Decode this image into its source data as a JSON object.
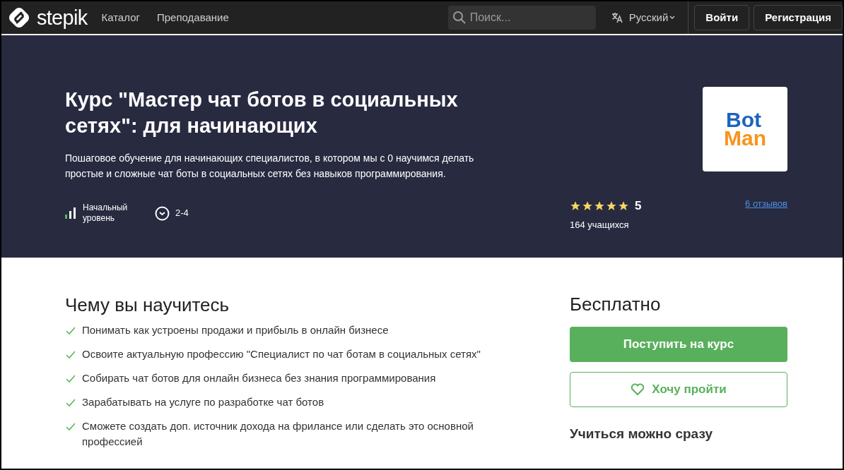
{
  "header": {
    "logo_text": "stepik",
    "nav": [
      "Каталог",
      "Преподавание"
    ],
    "search": {
      "placeholder": "Поиск..."
    },
    "language": "Русский",
    "buttons": [
      "Войти",
      "Регистрация"
    ]
  },
  "hero": {
    "title": "Курс \"Мастер чат ботов в социальных сетях\": для начинающих",
    "description": "Пошаговое обучение для начинающих специалистов, в котором мы с 0 научимся делать простые и сложные чат боты в социальных сетях без навыков программирования.",
    "level_label": "Начальный уровень",
    "duration": "2-4",
    "cover": {
      "line_1": "Bot",
      "line_2": "Man"
    },
    "stars": 5,
    "rating": "5",
    "students": "164 учащихся",
    "reviews": "6 отзывов"
  },
  "learn": {
    "title": "Чему вы научитесь",
    "items": [
      "Понимать как устроены продажи и прибыль в онлайн бизнесе",
      "Освоите актуальную профессию \"Специалист по чат ботам в социальных сетях\"",
      "Собирать чат ботов для онлайн бизнеса без знания программирования",
      "Зарабатывать на услуге по разработке чат ботов",
      "Сможете создать доп. источник дохода на фрилансе или сделать это основной профессией"
    ]
  },
  "offer": {
    "price": "Бесплатно",
    "enroll_button": "Поступить на курс",
    "wish_button": "Хочу пройти",
    "note": "Учиться можно сразу"
  }
}
